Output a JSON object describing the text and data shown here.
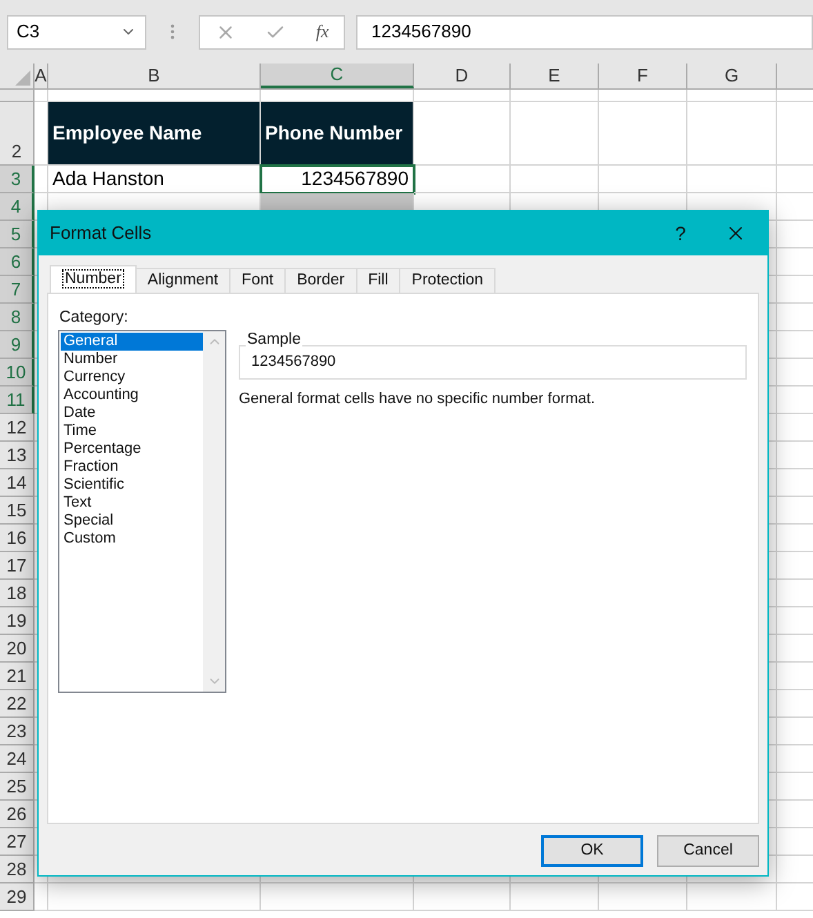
{
  "name_box": "C3",
  "formula_bar": {
    "fx_label": "fx",
    "value": "1234567890"
  },
  "columns": [
    {
      "label": "A",
      "selected": false
    },
    {
      "label": "B",
      "selected": false
    },
    {
      "label": "C",
      "selected": true
    },
    {
      "label": "D",
      "selected": false
    },
    {
      "label": "E",
      "selected": false
    },
    {
      "label": "F",
      "selected": false
    },
    {
      "label": "G",
      "selected": false
    }
  ],
  "rows": [
    {
      "selected": false
    },
    {
      "label": "2",
      "selected": false,
      "cells": [
        {
          "text": "Employee Name",
          "kind": "header",
          "selected": false,
          "active": false
        },
        {
          "text": "Phone Number",
          "kind": "header",
          "selected": false,
          "active": false
        }
      ]
    },
    {
      "label": "3",
      "selected": true,
      "cells": [
        {
          "text": "Ada Hanston",
          "kind": "text",
          "selected": false,
          "active": false
        },
        {
          "text": "1234567890",
          "kind": "number",
          "selected": false,
          "active": true
        }
      ]
    },
    {
      "label": "4",
      "selected": true,
      "cells": [
        {
          "kind": "text",
          "selected": false,
          "active": false
        },
        {
          "kind": "number",
          "selected": true,
          "active": false
        }
      ]
    },
    {
      "label": "5",
      "selected": true
    },
    {
      "label": "6",
      "selected": true
    },
    {
      "label": "7",
      "selected": true
    },
    {
      "label": "8",
      "selected": true
    },
    {
      "label": "9",
      "selected": true
    },
    {
      "label": "10",
      "selected": true
    },
    {
      "label": "11",
      "selected": true
    },
    {
      "label": "12",
      "selected": false
    },
    {
      "label": "13",
      "selected": false
    },
    {
      "label": "14",
      "selected": false
    },
    {
      "label": "15",
      "selected": false
    },
    {
      "label": "16",
      "selected": false
    },
    {
      "label": "17",
      "selected": false
    },
    {
      "label": "18",
      "selected": false
    },
    {
      "label": "19",
      "selected": false
    },
    {
      "label": "20",
      "selected": false
    },
    {
      "label": "21",
      "selected": false
    },
    {
      "label": "22",
      "selected": false
    },
    {
      "label": "23",
      "selected": false
    },
    {
      "label": "24",
      "selected": false
    },
    {
      "label": "25",
      "selected": false
    },
    {
      "label": "26",
      "selected": false
    },
    {
      "label": "27",
      "selected": false
    },
    {
      "label": "28",
      "selected": false
    },
    {
      "label": "29",
      "selected": false
    }
  ],
  "dialog": {
    "title": "Format Cells",
    "help": "?",
    "tabs": [
      {
        "label": "Number",
        "selected": true
      },
      {
        "label": "Alignment",
        "selected": false
      },
      {
        "label": "Font",
        "selected": false
      },
      {
        "label": "Border",
        "selected": false
      },
      {
        "label": "Fill",
        "selected": false
      },
      {
        "label": "Protection",
        "selected": false
      }
    ],
    "category_label": "Category:",
    "categories": [
      {
        "label": "General",
        "selected": true
      },
      {
        "label": "Number",
        "selected": false
      },
      {
        "label": "Currency",
        "selected": false
      },
      {
        "label": "Accounting",
        "selected": false
      },
      {
        "label": "Date",
        "selected": false
      },
      {
        "label": "Time",
        "selected": false
      },
      {
        "label": "Percentage",
        "selected": false
      },
      {
        "label": "Fraction",
        "selected": false
      },
      {
        "label": "Scientific",
        "selected": false
      },
      {
        "label": "Text",
        "selected": false
      },
      {
        "label": "Special",
        "selected": false
      },
      {
        "label": "Custom",
        "selected": false
      }
    ],
    "sample": {
      "label": "Sample",
      "value": "1234567890"
    },
    "description": "General format cells have no specific number format.",
    "buttons": [
      {
        "label": "OK",
        "kind": "default"
      },
      {
        "label": "Cancel",
        "kind": "normal"
      }
    ]
  }
}
